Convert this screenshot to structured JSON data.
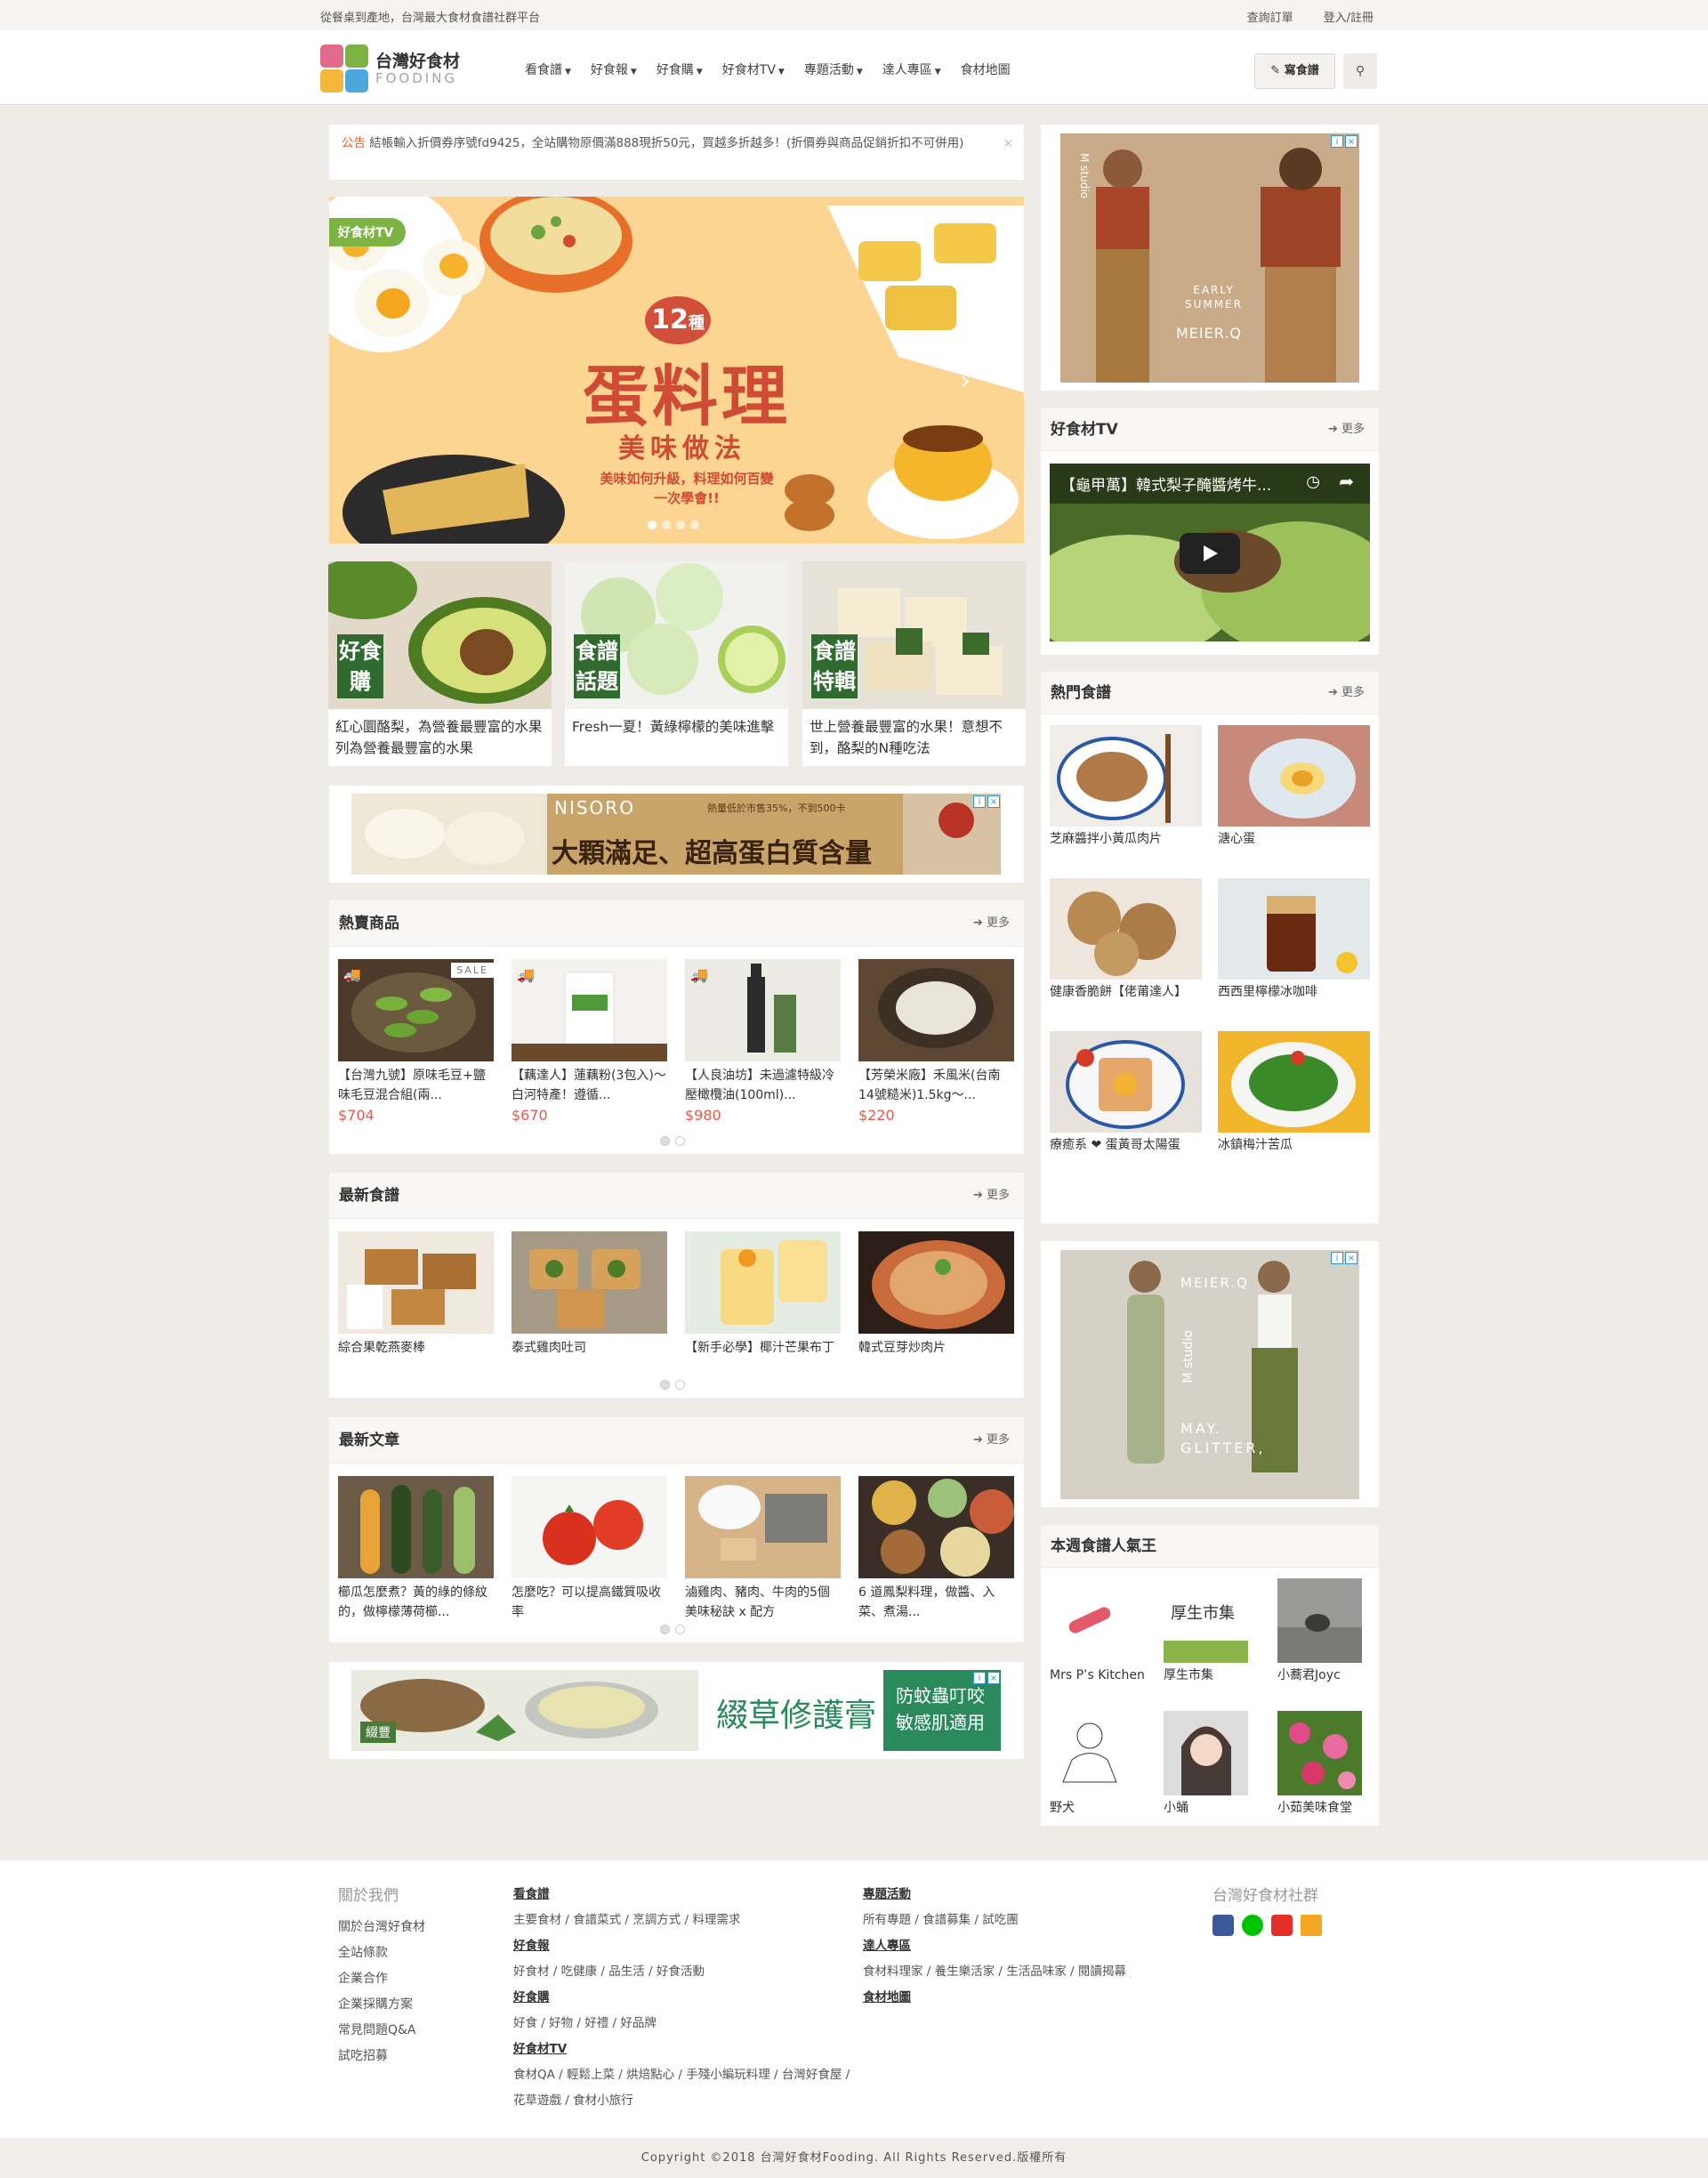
{
  "topbar": {
    "tagline": "從餐桌到產地，台灣最大食材食譜社群平台",
    "order": "查詢訂單",
    "login": "登入/註冊"
  },
  "header": {
    "logo_title": "台灣好食材",
    "logo_sub": "FOODING",
    "nav": [
      "看食譜",
      "好食報",
      "好食購",
      "好食材TV",
      "專題活動",
      "達人專區",
      "食材地圖"
    ],
    "write": "寫食譜"
  },
  "announce": {
    "label": "公告",
    "text": "結帳輸入折價券序號fd9425，全站購物原價滿888現折50元，買越多折越多！(折價券與商品促銷折扣不可併用)"
  },
  "hero": {
    "badge": "好食材TV",
    "num": "12",
    "num_unit": "種",
    "title": "蛋料理",
    "subtitle": "美味做法",
    "desc": "美味如何升級，料理如何百變 一次學會!!"
  },
  "cards": [
    {
      "tag": "好食購",
      "caption": "紅心圜酪梨，為營養最豐富的水果列為營養最豐富的水果"
    },
    {
      "tag": "食譜話題",
      "caption": "Fresh一夏！黃綠檸檬的美味進擊"
    },
    {
      "tag": "食譜特輯",
      "caption": "世上營養最豐富的水果！意想不到，酪梨的N種吃法"
    }
  ],
  "ad_banner1": {
    "brand": "NISORO",
    "note": "熱量低於市售35%，不到500卡",
    "text": "大顆滿足、超高蛋白質含量"
  },
  "hot": {
    "title": "熱賣商品",
    "more": "更多",
    "items": [
      {
        "name": "【台灣九號】原味毛豆+鹽味毛豆混合組(兩...",
        "price": "$704",
        "sale": "SALE"
      },
      {
        "name": "【藕達人】蓮藕粉(3包入)～白河特產！遵循...",
        "price": "$670"
      },
      {
        "name": "【人良油坊】未過濾特級冷壓橄欖油(100ml)...",
        "price": "$980"
      },
      {
        "name": "【芳榮米廠】禾風米(台南14號糙米)1.5kg～...",
        "price": "$220"
      }
    ]
  },
  "newrecipe": {
    "title": "最新食譜",
    "more": "更多",
    "items": [
      "綜合果乾燕麥棒",
      "泰式雞肉吐司",
      "【新手必學】椰汁芒果布丁",
      "韓式豆芽炒肉片"
    ]
  },
  "newarticle": {
    "title": "最新文章",
    "more": "更多",
    "items": [
      "櫛瓜怎麼煮？黃的綠的條紋的，做檸檬薄荷櫛...",
      "怎麼吃？可以提高鐵質吸收率",
      "滷雞肉、豬肉、牛肉的5個美味秘訣 x 配方",
      "6 道鳳梨料理，做醬、入菜、煮湯..."
    ]
  },
  "ad_banner2": {
    "tag": "綴豐",
    "text": "綴草修護膏",
    "text2": "防蚊蟲叮咬",
    "text3": "敏感肌適用"
  },
  "ad_side1": {
    "brand": "M studio",
    "line1": "EARLY",
    "line2": "SUMMER",
    "line3": "MEIER.Q"
  },
  "ad_side2": {
    "brand": "MEIER.Q",
    "vert": "M studio",
    "line1": "MAY.",
    "line2": "GLITTER,"
  },
  "tv": {
    "title": "好食材TV",
    "more": "更多",
    "video": "【龜甲萬】韓式梨子醃醬烤牛..."
  },
  "popular": {
    "title": "熱門食譜",
    "more": "更多",
    "items": [
      "芝麻醬拌小黃瓜肉片",
      "溏心蛋",
      "健康香脆餅【佬莆達人】",
      "西西里檸檬冰咖啡",
      "療癒系 ❤ 蛋黃哥太陽蛋",
      "冰鎮梅汁苦瓜"
    ]
  },
  "weekly": {
    "title": "本週食譜人氣王",
    "items": [
      "Mrs P’s Kitchen",
      "厚生市集",
      "小蕎君Joyc",
      "野犬",
      "小蛹",
      "小茹美味食堂"
    ]
  },
  "footer": {
    "about_title": "關於我們",
    "about": [
      "關於台灣好食材",
      "全站條款",
      "企業合作",
      "企業採購方案",
      "常見問題Q&A",
      "試吃招募"
    ],
    "g1": "看食譜",
    "g1l": "主要食材 / 食譜菜式 / 烹調方式 / 料理需求",
    "g2": "好食報",
    "g2l": "好食材 / 吃健康 / 品生活 / 好食活動",
    "g3": "好食購",
    "g3l": "好食 / 好物 / 好禮 / 好品牌",
    "g4": "好食材TV",
    "g4l": "食材QA / 輕鬆上菜 / 烘焙點心 / 手殘小編玩料理 / 台灣好食屋 / 花草遊戲 / 食材小旅行",
    "g5": "專題活動",
    "g5l": "所有專題 / 食譜募集 / 試吃團",
    "g6": "達人專區",
    "g6l": "食材料理家 / 養生樂活家 / 生活品味家 / 閱讀揭幕",
    "g7": "食材地圖",
    "social_title": "台灣好食材社群",
    "copy": "Copyright ©2018 台灣好食材Fooding. All Rights Reserved.版權所有"
  },
  "colors": {
    "accent": "#e35b4b",
    "green": "#7cb342",
    "bg": "#efebe6"
  }
}
